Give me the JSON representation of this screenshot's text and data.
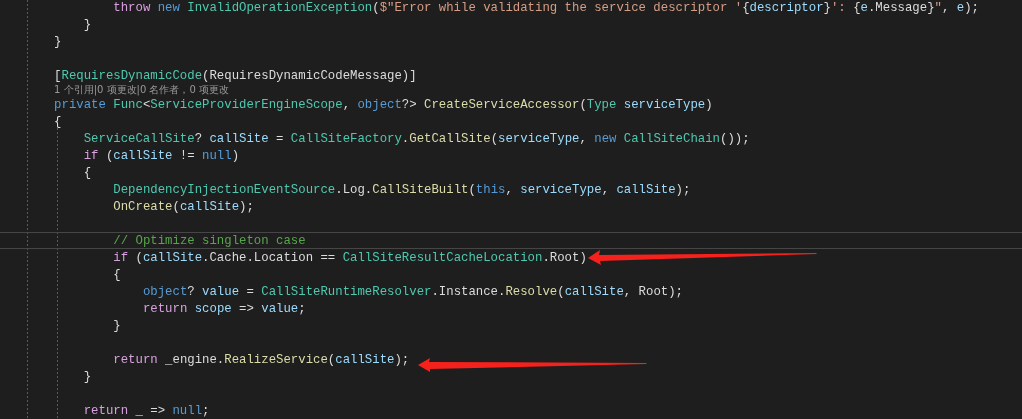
{
  "editor": {
    "lines": [
      {
        "kind": "group",
        "children": [
          {
            "kind": "group",
            "children": [
              {
                "kind": "group",
                "children": [
                  {
                    "kind": "code",
                    "current": false,
                    "tokens": [
                      {
                        "kind": "control",
                        "text": "throw "
                      },
                      {
                        "kind": "keyword",
                        "text": "new "
                      },
                      {
                        "kind": "type",
                        "text": "InvalidOperationException"
                      },
                      {
                        "kind": "plain",
                        "text": "("
                      },
                      {
                        "kind": "string",
                        "text": "$\"Error while validating the service descriptor '"
                      },
                      {
                        "kind": "plain",
                        "text": "{"
                      },
                      {
                        "kind": "variable",
                        "text": "descriptor"
                      },
                      {
                        "kind": "plain",
                        "text": "}"
                      },
                      {
                        "kind": "string",
                        "text": "': "
                      },
                      {
                        "kind": "plain",
                        "text": "{"
                      },
                      {
                        "kind": "variable",
                        "text": "e"
                      },
                      {
                        "kind": "plain",
                        "text": ".Message}"
                      },
                      {
                        "kind": "string",
                        "text": "\""
                      },
                      {
                        "kind": "plain",
                        "text": ", "
                      },
                      {
                        "kind": "variable",
                        "text": "e"
                      },
                      {
                        "kind": "plain",
                        "text": ");"
                      }
                    ]
                  }
                ]
              },
              {
                "kind": "code",
                "current": false,
                "tokens": [
                  {
                    "kind": "plain",
                    "text": "}"
                  }
                ]
              }
            ]
          },
          {
            "kind": "code",
            "current": false,
            "tokens": [
              {
                "kind": "plain",
                "text": "}"
              }
            ]
          }
        ]
      },
      {
        "kind": "blank",
        "current": false
      },
      {
        "kind": "group",
        "children": [
          {
            "kind": "code",
            "current": false,
            "tokens": [
              {
                "kind": "plain",
                "text": "["
              },
              {
                "kind": "type",
                "text": "RequiresDynamicCode"
              },
              {
                "kind": "plain",
                "text": "(RequiresDynamicCodeMessage)]"
              }
            ]
          },
          {
            "kind": "codelens",
            "current": false,
            "text": "1 个引用|0 项更改|0 名作者，0 项更改"
          },
          {
            "kind": "code",
            "current": false,
            "tokens": [
              {
                "kind": "keyword",
                "text": "private "
              },
              {
                "kind": "type",
                "text": "Func"
              },
              {
                "kind": "plain",
                "text": "<"
              },
              {
                "kind": "type",
                "text": "ServiceProviderEngineScope"
              },
              {
                "kind": "plain",
                "text": ", "
              },
              {
                "kind": "keyword",
                "text": "object"
              },
              {
                "kind": "plain",
                "text": "?> "
              },
              {
                "kind": "method",
                "text": "CreateServiceAccessor"
              },
              {
                "kind": "plain",
                "text": "("
              },
              {
                "kind": "type",
                "text": "Type "
              },
              {
                "kind": "variable",
                "text": "serviceType"
              },
              {
                "kind": "plain",
                "text": ")"
              }
            ]
          },
          {
            "kind": "code",
            "current": false,
            "tokens": [
              {
                "kind": "plain",
                "text": "{"
              }
            ]
          },
          {
            "kind": "group",
            "children": [
              {
                "kind": "code",
                "current": false,
                "tokens": [
                  {
                    "kind": "type",
                    "text": "ServiceCallSite"
                  },
                  {
                    "kind": "plain",
                    "text": "? "
                  },
                  {
                    "kind": "variable",
                    "text": "callSite"
                  },
                  {
                    "kind": "plain",
                    "text": " = "
                  },
                  {
                    "kind": "type",
                    "text": "CallSiteFactory"
                  },
                  {
                    "kind": "plain",
                    "text": "."
                  },
                  {
                    "kind": "method",
                    "text": "GetCallSite"
                  },
                  {
                    "kind": "plain",
                    "text": "("
                  },
                  {
                    "kind": "variable",
                    "text": "serviceType"
                  },
                  {
                    "kind": "plain",
                    "text": ", "
                  },
                  {
                    "kind": "keyword",
                    "text": "new "
                  },
                  {
                    "kind": "type",
                    "text": "CallSiteChain"
                  },
                  {
                    "kind": "plain",
                    "text": "());"
                  }
                ]
              },
              {
                "kind": "code",
                "current": false,
                "tokens": [
                  {
                    "kind": "control",
                    "text": "if"
                  },
                  {
                    "kind": "plain",
                    "text": " ("
                  },
                  {
                    "kind": "variable",
                    "text": "callSite"
                  },
                  {
                    "kind": "plain",
                    "text": " != "
                  },
                  {
                    "kind": "keyword",
                    "text": "null"
                  },
                  {
                    "kind": "plain",
                    "text": ")"
                  }
                ]
              },
              {
                "kind": "code",
                "current": false,
                "tokens": [
                  {
                    "kind": "plain",
                    "text": "{"
                  }
                ]
              },
              {
                "kind": "group",
                "children": [
                  {
                    "kind": "code",
                    "current": false,
                    "tokens": [
                      {
                        "kind": "type",
                        "text": "DependencyInjectionEventSource"
                      },
                      {
                        "kind": "plain",
                        "text": ".Log."
                      },
                      {
                        "kind": "method",
                        "text": "CallSiteBuilt"
                      },
                      {
                        "kind": "plain",
                        "text": "("
                      },
                      {
                        "kind": "keyword",
                        "text": "this"
                      },
                      {
                        "kind": "plain",
                        "text": ", "
                      },
                      {
                        "kind": "variable",
                        "text": "serviceType"
                      },
                      {
                        "kind": "plain",
                        "text": ", "
                      },
                      {
                        "kind": "variable",
                        "text": "callSite"
                      },
                      {
                        "kind": "plain",
                        "text": ");"
                      }
                    ]
                  },
                  {
                    "kind": "code",
                    "current": false,
                    "tokens": [
                      {
                        "kind": "method",
                        "text": "OnCreate"
                      },
                      {
                        "kind": "plain",
                        "text": "("
                      },
                      {
                        "kind": "variable",
                        "text": "callSite"
                      },
                      {
                        "kind": "plain",
                        "text": ");"
                      }
                    ]
                  },
                  {
                    "kind": "blank",
                    "current": false
                  },
                  {
                    "kind": "code",
                    "current": true,
                    "tokens": [
                      {
                        "kind": "comment",
                        "text": "// Optimize singleton case"
                      }
                    ]
                  },
                  {
                    "kind": "code",
                    "current": false,
                    "tokens": [
                      {
                        "kind": "control",
                        "text": "if"
                      },
                      {
                        "kind": "plain",
                        "text": " ("
                      },
                      {
                        "kind": "variable",
                        "text": "callSite"
                      },
                      {
                        "kind": "plain",
                        "text": ".Cache.Location == "
                      },
                      {
                        "kind": "type",
                        "text": "CallSiteResultCacheLocation"
                      },
                      {
                        "kind": "plain",
                        "text": ".Root)"
                      }
                    ]
                  },
                  {
                    "kind": "code",
                    "current": false,
                    "tokens": [
                      {
                        "kind": "plain",
                        "text": "{"
                      }
                    ]
                  },
                  {
                    "kind": "group",
                    "children": [
                      {
                        "kind": "code",
                        "current": false,
                        "tokens": [
                          {
                            "kind": "keyword",
                            "text": "object"
                          },
                          {
                            "kind": "plain",
                            "text": "? "
                          },
                          {
                            "kind": "variable",
                            "text": "value"
                          },
                          {
                            "kind": "plain",
                            "text": " = "
                          },
                          {
                            "kind": "type",
                            "text": "CallSiteRuntimeResolver"
                          },
                          {
                            "kind": "plain",
                            "text": ".Instance."
                          },
                          {
                            "kind": "method",
                            "text": "Resolve"
                          },
                          {
                            "kind": "plain",
                            "text": "("
                          },
                          {
                            "kind": "variable",
                            "text": "callSite"
                          },
                          {
                            "kind": "plain",
                            "text": ", Root);"
                          }
                        ]
                      },
                      {
                        "kind": "code",
                        "current": false,
                        "tokens": [
                          {
                            "kind": "control",
                            "text": "return "
                          },
                          {
                            "kind": "variable",
                            "text": "scope"
                          },
                          {
                            "kind": "plain",
                            "text": " => "
                          },
                          {
                            "kind": "variable",
                            "text": "value"
                          },
                          {
                            "kind": "plain",
                            "text": ";"
                          }
                        ]
                      }
                    ]
                  },
                  {
                    "kind": "code",
                    "current": false,
                    "tokens": [
                      {
                        "kind": "plain",
                        "text": "}"
                      }
                    ]
                  },
                  {
                    "kind": "blank",
                    "current": false
                  },
                  {
                    "kind": "code",
                    "current": false,
                    "tokens": [
                      {
                        "kind": "control",
                        "text": "return"
                      },
                      {
                        "kind": "plain",
                        "text": " _engine."
                      },
                      {
                        "kind": "method",
                        "text": "RealizeService"
                      },
                      {
                        "kind": "plain",
                        "text": "("
                      },
                      {
                        "kind": "variable",
                        "text": "callSite"
                      },
                      {
                        "kind": "plain",
                        "text": ");"
                      }
                    ]
                  }
                ]
              },
              {
                "kind": "code",
                "current": false,
                "tokens": [
                  {
                    "kind": "plain",
                    "text": "}"
                  }
                ]
              },
              {
                "kind": "blank",
                "current": false
              },
              {
                "kind": "code",
                "current": false,
                "tokens": [
                  {
                    "kind": "control",
                    "text": "return"
                  },
                  {
                    "kind": "plain",
                    "text": " _ => "
                  },
                  {
                    "kind": "keyword",
                    "text": "null"
                  },
                  {
                    "kind": "plain",
                    "text": ";"
                  }
                ]
              }
            ]
          }
        ]
      }
    ]
  }
}
